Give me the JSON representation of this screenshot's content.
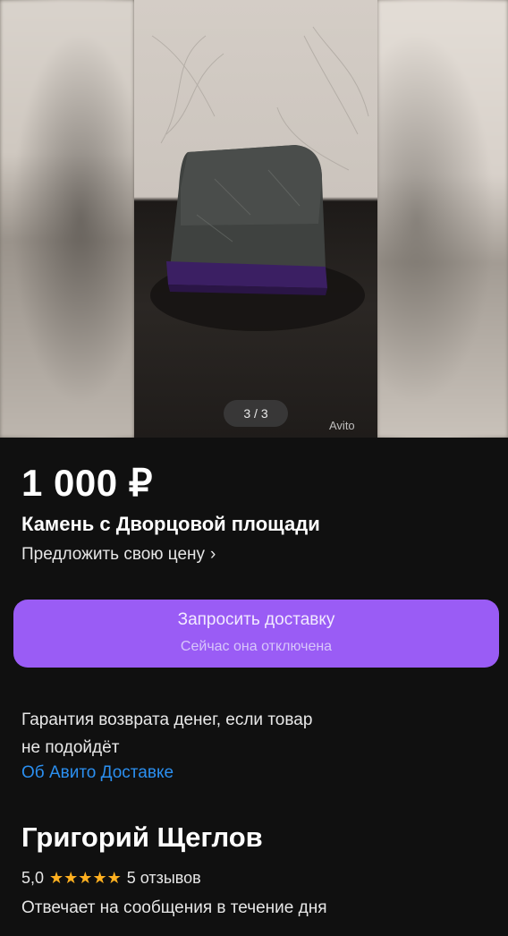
{
  "gallery": {
    "counter": "3 / 3",
    "watermark": "Avito"
  },
  "listing": {
    "price": "1 000 ₽",
    "title": "Камень с Дворцовой площади",
    "offer_label": "Предложить свою цену",
    "offer_chevron": "›"
  },
  "delivery": {
    "button_label": "Запросить доставку",
    "button_sublabel": "Сейчас она отключена",
    "button_color": "#9a5cf5"
  },
  "guarantee": {
    "line1": "Гарантия возврата денег, если товар",
    "line2": "не подойдёт",
    "link": "Об Авито Доставке",
    "link_color": "#2b8ff0"
  },
  "seller": {
    "name": "Григорий Щеглов",
    "rating": "5,0",
    "stars": "★★★★★",
    "star_color": "#ffb020",
    "reviews": "5 отзывов",
    "response_time": "Отвечает на сообщения в течение дня"
  }
}
